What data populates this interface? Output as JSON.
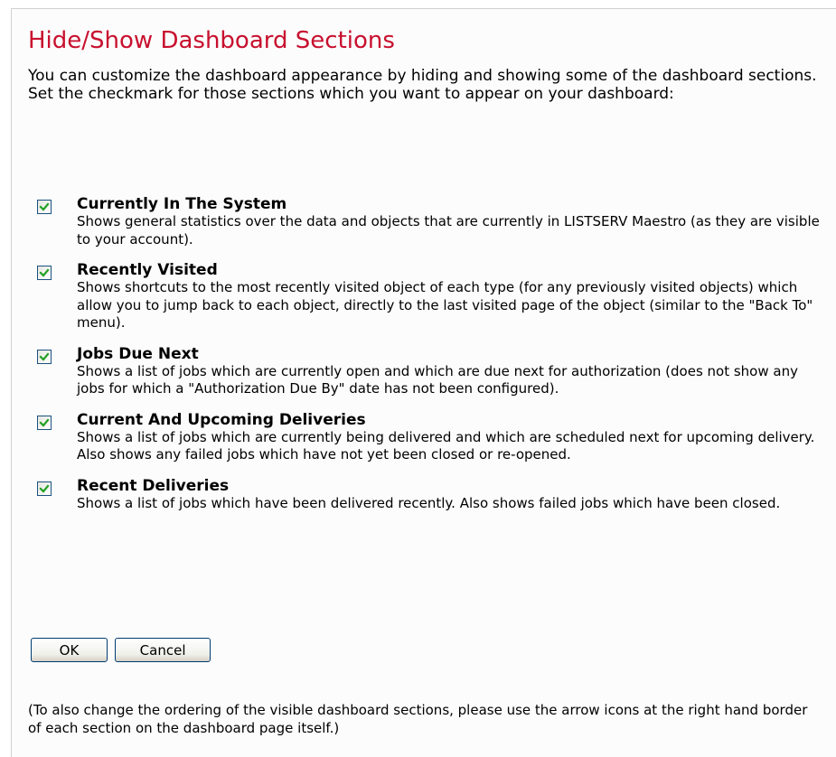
{
  "header": {
    "title": "Hide/Show Dashboard Sections"
  },
  "intro": {
    "line1": "You can customize the dashboard appearance by hiding and showing some of the dashboard sections.",
    "line2": "Set the checkmark for those sections which you want to appear on your dashboard:"
  },
  "sections": [
    {
      "label": "Currently In The System",
      "description": "Shows general statistics over the data and objects that are currently in LISTSERV Maestro (as they are visible to your account).",
      "checked": true
    },
    {
      "label": "Recently Visited",
      "description": "Shows shortcuts to the most recently visited object of each type (for any previously visited objects) which allow you to jump back to each object, directly to the last visited page of the object (similar to the \"Back To\" menu).",
      "checked": true
    },
    {
      "label": "Jobs Due Next",
      "description": "Shows a list of jobs which are currently open and which are due next for authorization (does not show any jobs for which a \"Authorization Due By\" date has not been configured).",
      "checked": true
    },
    {
      "label": "Current And Upcoming Deliveries",
      "description": "Shows a list of jobs which are currently being delivered and which are scheduled next for upcoming delivery. Also shows any failed jobs which have not yet been closed or re-opened.",
      "checked": true
    },
    {
      "label": "Recent Deliveries",
      "description": "Shows a list of jobs which have been delivered recently. Also shows failed jobs which have been closed.",
      "checked": true
    }
  ],
  "buttons": {
    "ok_label": "OK",
    "cancel_label": "Cancel"
  },
  "footnote": "(To also change the ordering of the visible dashboard sections, please use the arrow icons at the right hand border of each section on the dashboard page itself.)",
  "colors": {
    "title": "#c8102e",
    "checkmark": "#21a121",
    "checkbox_border": "#1c5180"
  },
  "icons": {
    "checkbox": "checkmark-icon"
  }
}
